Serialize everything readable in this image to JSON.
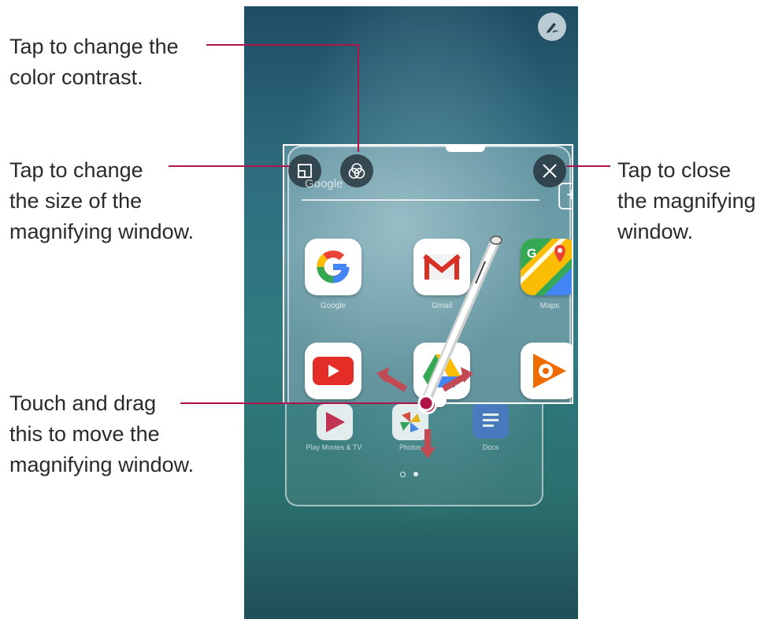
{
  "callouts": {
    "contrast": [
      "Tap to change the",
      "color contrast."
    ],
    "size": [
      "Tap to change",
      "the size of the",
      "magnifying window."
    ],
    "move": [
      "Touch and drag",
      "this to move the",
      "magnifying window."
    ],
    "close": [
      "Tap to close",
      "the magnifying",
      "window."
    ]
  },
  "magnifier": {
    "search_text": "Google",
    "plus_label": "+",
    "apps_row1": [
      "Google",
      "Gmail",
      "Maps"
    ],
    "apps_row2": [
      "YouTube",
      "Drive",
      "Play Music"
    ]
  },
  "background_apps": {
    "row": [
      "Play Movies & TV",
      "Photos",
      "Docs"
    ]
  },
  "icons": {
    "resize": "resize-window-icon",
    "contrast": "color-contrast-icon",
    "close": "close-icon",
    "pen": "pen-icon",
    "stylus": "stylus-icon",
    "arrows": "move-arrows-icon"
  },
  "colors": {
    "callout_line": "#b0124a",
    "drag_point": "#b0124a"
  }
}
